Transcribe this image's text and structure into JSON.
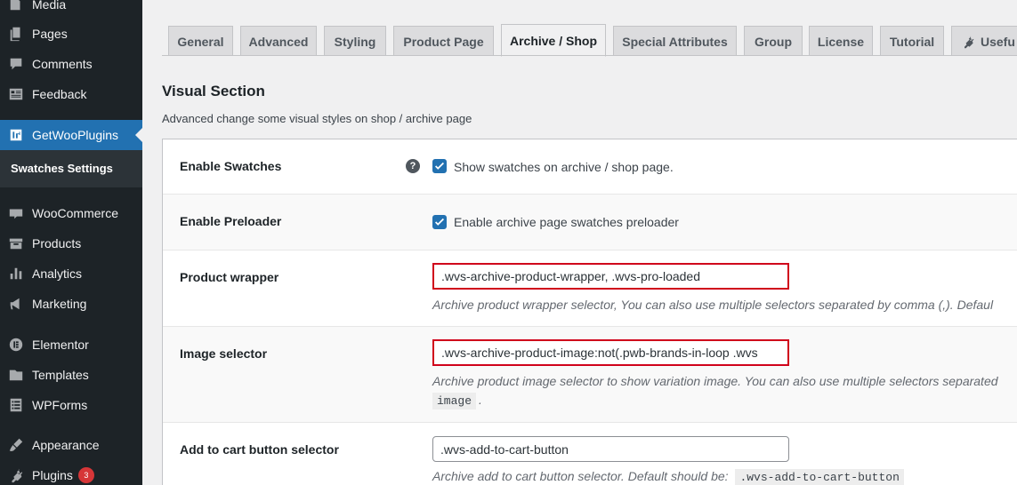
{
  "sidebar": {
    "items": [
      {
        "label": "Media",
        "icon": "media-icon"
      },
      {
        "label": "Pages",
        "icon": "pages-icon"
      },
      {
        "label": "Comments",
        "icon": "comments-icon"
      },
      {
        "label": "Feedback",
        "icon": "feedback-icon"
      },
      {
        "label": "GetWooPlugins",
        "icon": "getwooplugins-icon"
      },
      {
        "label": "WooCommerce",
        "icon": "woocommerce-icon"
      },
      {
        "label": "Products",
        "icon": "products-icon"
      },
      {
        "label": "Analytics",
        "icon": "analytics-icon"
      },
      {
        "label": "Marketing",
        "icon": "marketing-icon"
      },
      {
        "label": "Elementor",
        "icon": "elementor-icon"
      },
      {
        "label": "Templates",
        "icon": "templates-icon"
      },
      {
        "label": "WPForms",
        "icon": "wpforms-icon"
      },
      {
        "label": "Appearance",
        "icon": "appearance-icon"
      },
      {
        "label": "Plugins",
        "icon": "plugins-icon",
        "badge": "3"
      }
    ],
    "submenu_item": "Swatches Settings",
    "active_color": "#2271b1"
  },
  "tabs": [
    {
      "label": "General"
    },
    {
      "label": "Advanced"
    },
    {
      "label": "Styling"
    },
    {
      "label": "Product Page"
    },
    {
      "label": "Archive / Shop",
      "active": true
    },
    {
      "label": "Special Attributes"
    },
    {
      "label": "Group"
    },
    {
      "label": "License"
    },
    {
      "label": "Tutorial"
    },
    {
      "label": "Usefu",
      "icon": "plug-icon"
    }
  ],
  "section": {
    "title": "Visual Section",
    "description": "Advanced change some visual styles on shop / archive page"
  },
  "rows": {
    "enable_swatches": {
      "label": "Enable Swatches",
      "help": "?",
      "checked": true,
      "checkbox_label": "Show swatches on archive / shop page."
    },
    "enable_preloader": {
      "label": "Enable Preloader",
      "checked": true,
      "checkbox_label": "Enable archive page swatches preloader"
    },
    "product_wrapper": {
      "label": "Product wrapper",
      "value": ".wvs-archive-product-wrapper, .wvs-pro-loaded",
      "description": "Archive product wrapper selector, You can also use multiple selectors separated by comma (,). Defaul"
    },
    "image_selector": {
      "label": "Image selector",
      "value": ".wvs-archive-product-image:not(.pwb-brands-in-loop .wvs",
      "description": "Archive product image selector to show variation image. You can also use multiple selectors separated",
      "description_code": "image",
      "description_tail": "."
    },
    "add_to_cart": {
      "label": "Add to cart button selector",
      "value": ".wvs-add-to-cart-button",
      "description": "Archive add to cart button selector. Default should be:",
      "description_code": ".wvs-add-to-cart-button"
    }
  },
  "colors": {
    "highlight_border": "#d0021b",
    "checkbox": "#2271b1",
    "badge": "#d63638"
  }
}
